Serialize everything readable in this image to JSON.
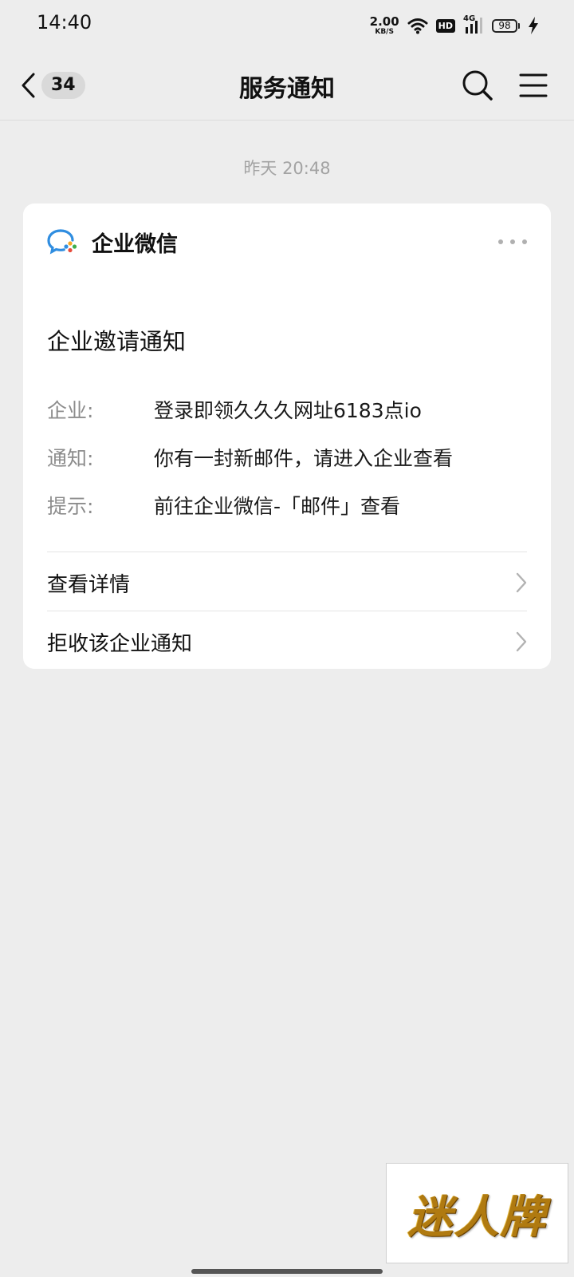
{
  "status_bar": {
    "time": "14:40",
    "net_speed_value": "2.00",
    "net_speed_unit": "KB/S",
    "hd_label": "HD",
    "network_label": "4G",
    "battery_level": "98",
    "icons": [
      "wifi-icon",
      "hd-icon",
      "signal-icon",
      "battery-icon",
      "charging-icon"
    ]
  },
  "nav": {
    "title": "服务通知",
    "unread_count": "34",
    "icons": [
      "back-chevron-icon",
      "search-icon",
      "menu-icon"
    ]
  },
  "timestamp": "昨天 20:48",
  "card": {
    "app_name": "企业微信",
    "title": "企业邀请通知",
    "fields": [
      {
        "label": "企业:",
        "value": "登录即领久久久网址6183点io"
      },
      {
        "label": "通知:",
        "value": "你有一封新邮件，请进入企业查看"
      },
      {
        "label": "提示:",
        "value": "前往企业微信-「邮件」查看"
      }
    ],
    "actions": [
      {
        "label": "查看详情"
      },
      {
        "label": "拒收该企业通知"
      }
    ]
  },
  "watermark": {
    "text": "迷人牌"
  },
  "colors": {
    "background": "#ededed",
    "card": "#ffffff",
    "muted_text": "#8c8c8c",
    "logo_blue": "#2f8de0",
    "watermark_gold": "#b07a10"
  }
}
